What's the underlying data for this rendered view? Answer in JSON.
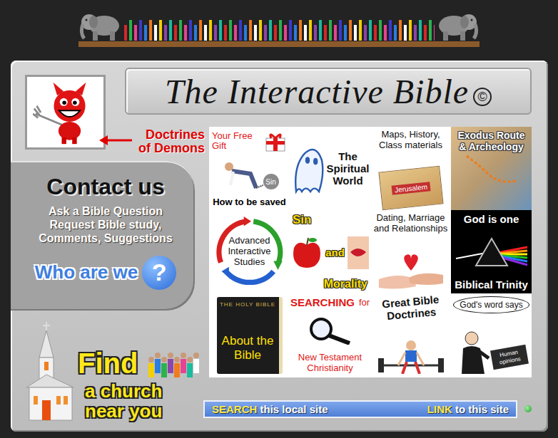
{
  "logo": {
    "title": "The Interactive Bible",
    "mark": "©"
  },
  "demons": {
    "label": "Doctrines of Demons"
  },
  "contact": {
    "title": "Contact us",
    "lines": [
      "Ask a Bible Question",
      "Request Bible study,",
      "Comments, Suggestions"
    ]
  },
  "about": {
    "label": "Who are we",
    "mark": "?"
  },
  "church": {
    "title": "Find",
    "subtitle": "a church near you"
  },
  "tiles": [
    {
      "kind": "gift",
      "top": "Your Free Gift",
      "chain": "Sin",
      "label": "How to be saved"
    },
    {
      "kind": "ghost",
      "label": "The Spiritual World"
    },
    {
      "kind": "map",
      "label": "Maps, History, Class materials",
      "map": "Jerusalem"
    },
    {
      "kind": "photo",
      "label": "Exodus Route & Archeology"
    },
    {
      "kind": "cycle",
      "label": "Advanced Interactive Studies"
    },
    {
      "kind": "apple",
      "words": [
        "Sin",
        "and",
        "Morality"
      ]
    },
    {
      "kind": "hands",
      "label": "Dating, Marriage and Relationships"
    },
    {
      "kind": "prism",
      "top": "God is one",
      "label": "Biblical Trinity"
    },
    {
      "kind": "book",
      "cover": "THE HOLY BIBLE",
      "label": "About the Bible"
    },
    {
      "kind": "search",
      "top": "SEARCHING",
      "join": "for",
      "label": "New Testament Christianity"
    },
    {
      "kind": "lifter",
      "label": "Great Bible Doctrines"
    },
    {
      "kind": "preacher",
      "bubble": "God's word says",
      "book": "Human opinions"
    }
  ],
  "bottom_bar": {
    "search": {
      "key": "SEARCH",
      "rest": "this local site"
    },
    "link": {
      "key": "LINK",
      "rest": "to this site"
    }
  }
}
